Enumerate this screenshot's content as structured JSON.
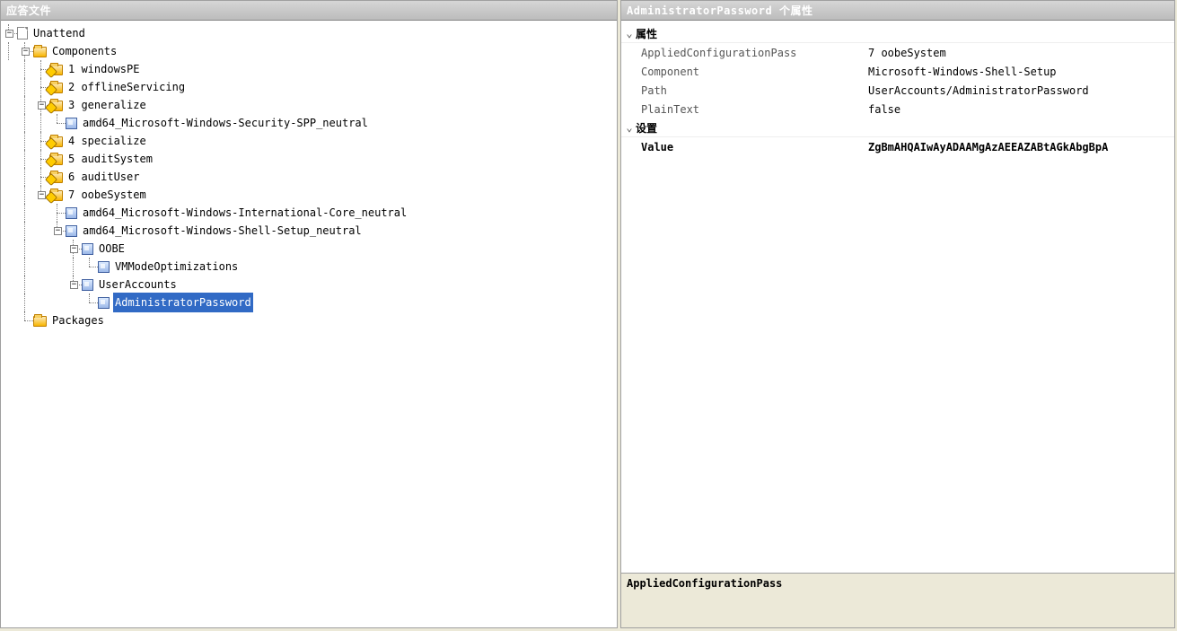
{
  "left_panel": {
    "title": "应答文件"
  },
  "right_panel": {
    "title": "AdministratorPassword 个属性"
  },
  "tree": {
    "root": "Unattend",
    "components": "Components",
    "p1": "1 windowsPE",
    "p2": "2 offlineServicing",
    "p3": "3 generalize",
    "p3c1": "amd64_Microsoft-Windows-Security-SPP_neutral",
    "p4": "4 specialize",
    "p5": "5 auditSystem",
    "p6": "6 auditUser",
    "p7": "7 oobeSystem",
    "p7c1": "amd64_Microsoft-Windows-International-Core_neutral",
    "p7c2": "amd64_Microsoft-Windows-Shell-Setup_neutral",
    "oobe": "OOBE",
    "vmmode": "VMModeOptimizations",
    "useraccounts": "UserAccounts",
    "adminpw": "AdministratorPassword",
    "packages": "Packages"
  },
  "categories": {
    "attributes": "属性",
    "settings": "设置"
  },
  "properties": {
    "appliedpass_name": "AppliedConfigurationPass",
    "appliedpass_val": "7 oobeSystem",
    "component_name": "Component",
    "component_val": "Microsoft-Windows-Shell-Setup",
    "path_name": "Path",
    "path_val": "UserAccounts/AdministratorPassword",
    "plaintext_name": "PlainText",
    "plaintext_val": "false",
    "value_name": "Value",
    "value_val": "ZgBmAHQAIwAyADAAMgAzAEEAZABtAGkAbgBpA"
  },
  "description": {
    "title": "AppliedConfigurationPass"
  },
  "glyphs": {
    "minus": "−",
    "plus": "+",
    "chev": "⌄"
  }
}
